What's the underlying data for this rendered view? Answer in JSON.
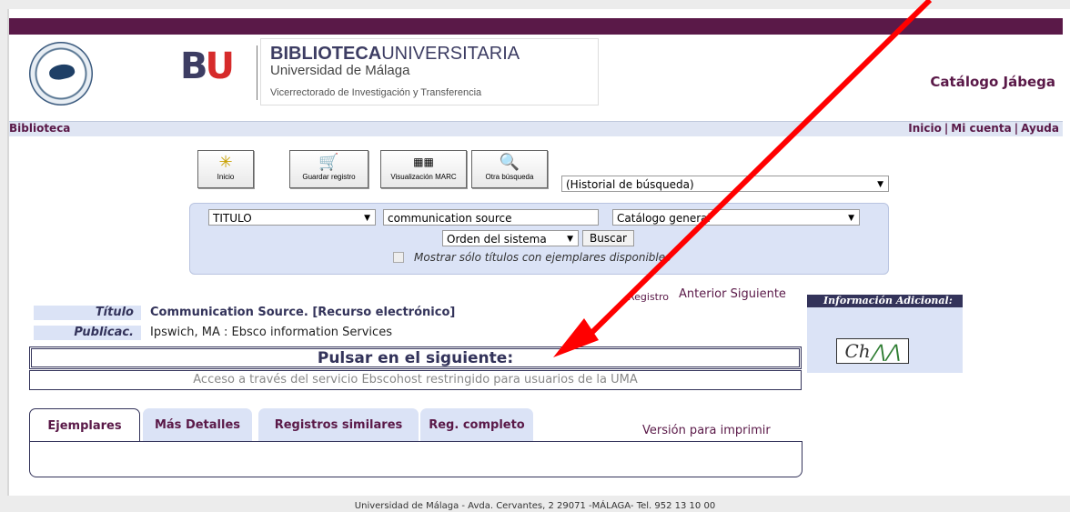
{
  "header": {
    "logo_bu": "BU",
    "logo_line1_bold": "BIBLIOTECA",
    "logo_line1_thin": "UNIVERSITARIA",
    "logo_line2": "Universidad de Málaga",
    "logo_line3": "Vicerrectorado de Investigación y Transferencia",
    "catalog_title": "Catálogo Jábega"
  },
  "nav": {
    "left": "Biblioteca",
    "inicio": "Inicio",
    "mi_cuenta": "Mi cuenta",
    "ayuda": "Ayuda",
    "sep": "|"
  },
  "toolbar": {
    "inicio": "Inicio",
    "guardar": "Guardar registro",
    "marc": "Visualización MARC",
    "otra": "Otra búsqueda",
    "historial": "(Historial de búsqueda)"
  },
  "search": {
    "field": "TITULO",
    "query": "communication source",
    "catalog": "Catálogo general",
    "order": "Orden del sistema",
    "buscar": "Buscar",
    "checkbox_label": "Mostrar sólo títulos con ejemplares disponibles"
  },
  "registro": {
    "label": "Registro",
    "anterior": "Anterior",
    "siguiente": "Siguiente"
  },
  "info": {
    "title": "Información Adicional:",
    "logo_text": "Ch"
  },
  "record": {
    "titulo_label": "Título",
    "titulo_value": "Communication Source. [Recurso electrónico]",
    "public_label": "Publicac.",
    "public_value": "Ipswich, MA : Ebsco information Services"
  },
  "links": {
    "pulsar": "Pulsar en el siguiente:",
    "acceso": "Acceso a través del servicio Ebscohost restringido para usuarios de la UMA"
  },
  "tabs": {
    "ejemplares": "Ejemplares",
    "mas_detalles": "Más Detalles",
    "similares": "Registros similares",
    "completo": "Reg. completo",
    "imprimir": "Versión para imprimir"
  },
  "footer": "Universidad de Málaga - Avda. Cervantes, 2 29071 -MÁLAGA- Tel. 952 13 10 00",
  "colors": {
    "brand": "#5a1948",
    "panel": "#dbe3f6",
    "annotation_arrow": "#ff0000"
  }
}
